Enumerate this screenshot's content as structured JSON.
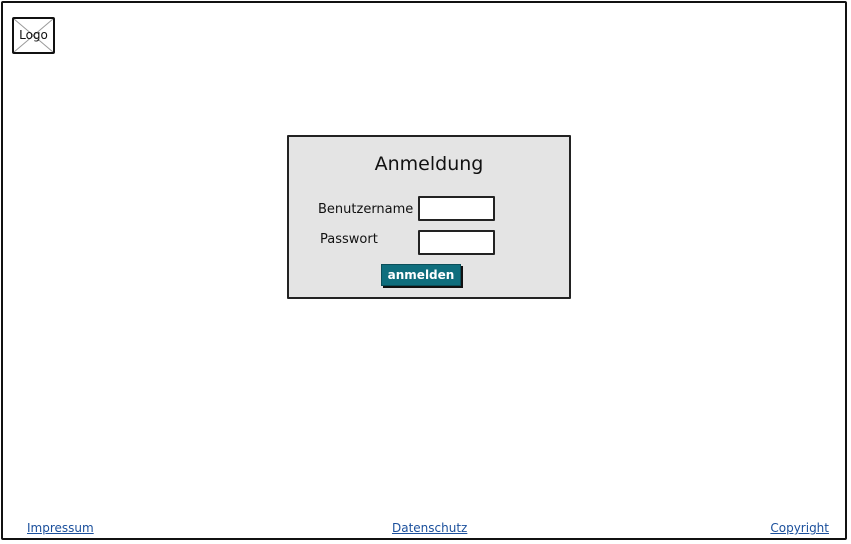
{
  "header": {
    "logo_text": "Logo"
  },
  "login": {
    "title": "Anmeldung",
    "username_label": "Benutzername",
    "username_value": "",
    "password_label": "Passwort",
    "password_value": "",
    "submit_label": "anmelden",
    "submit_color": "#0f6e7d"
  },
  "footer": {
    "impressum": "Impressum",
    "datenschutz": "Datenschutz",
    "copyright": "Copyright"
  }
}
